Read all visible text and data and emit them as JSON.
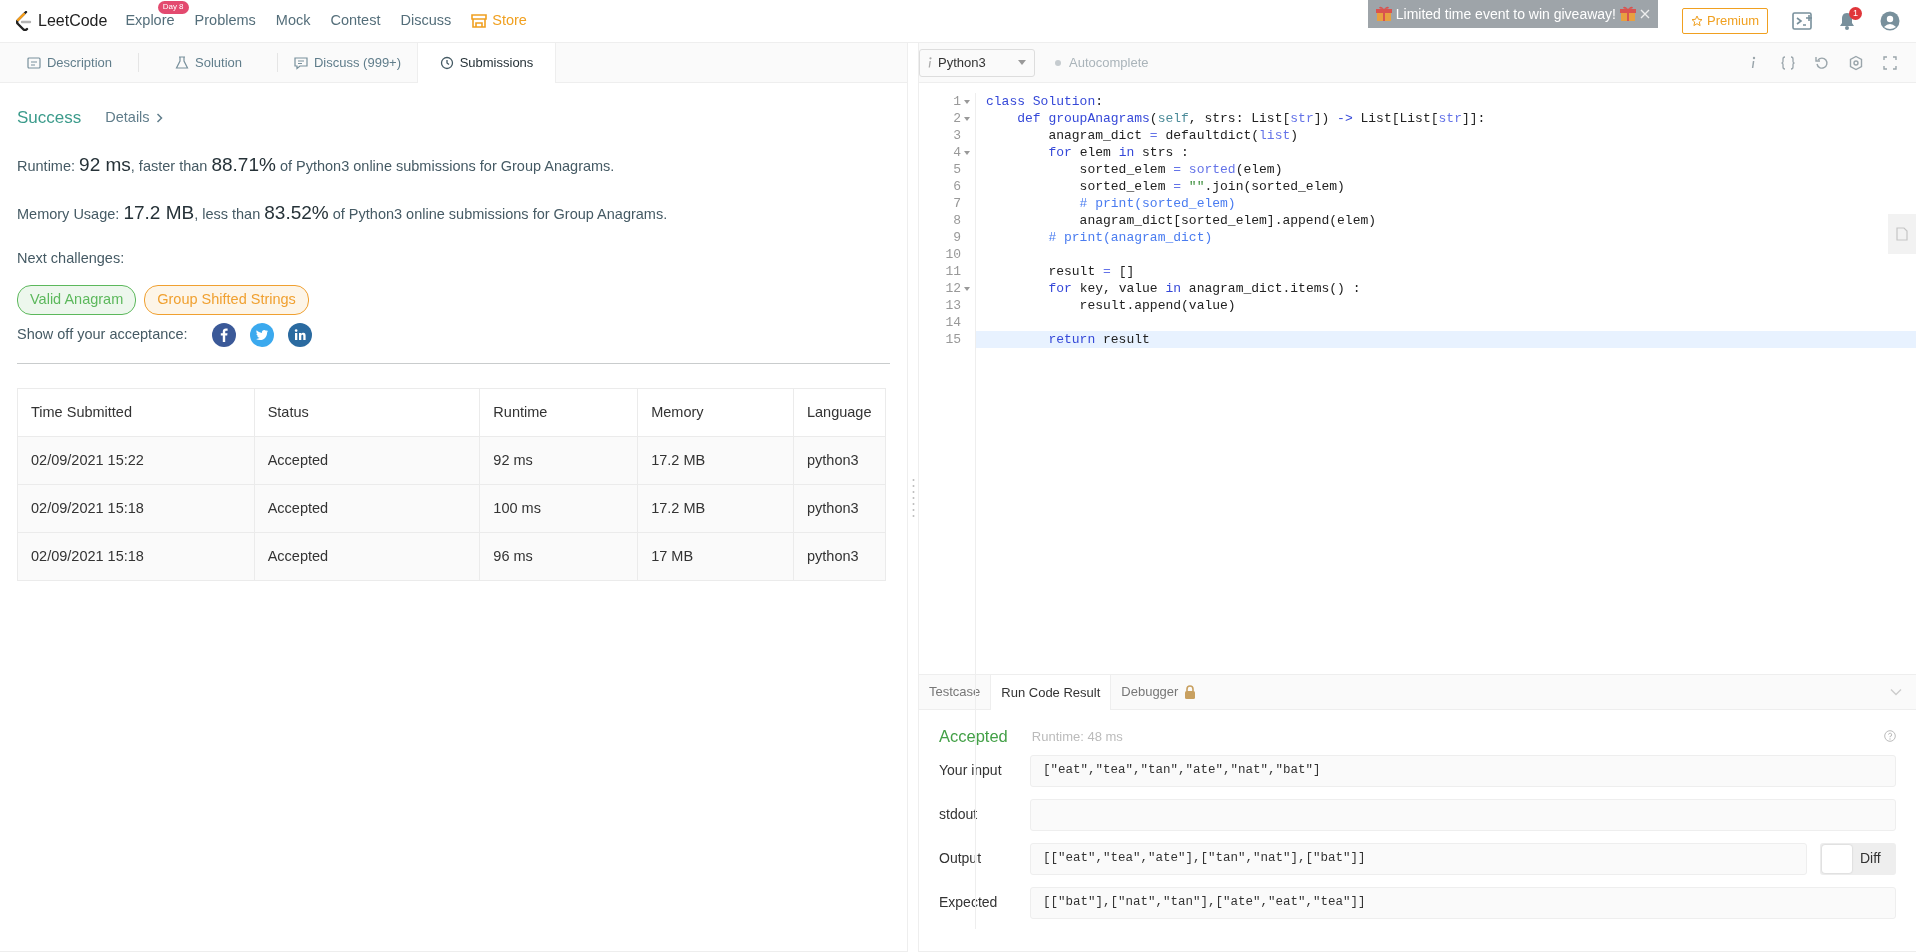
{
  "nav": {
    "logo": "LeetCode",
    "items": [
      {
        "label": "Explore",
        "badge": "Day 8",
        "kind": "plain"
      },
      {
        "label": "Problems",
        "kind": "plain"
      },
      {
        "label": "Mock",
        "kind": "plain"
      },
      {
        "label": "Contest",
        "kind": "plain"
      },
      {
        "label": "Discuss",
        "kind": "plain"
      },
      {
        "label": "Store",
        "kind": "store"
      }
    ],
    "toast": "Limited time event to win giveaway!",
    "premium": "Premium",
    "notifications": "1"
  },
  "left_tabs": [
    {
      "label": "Description",
      "selected": false
    },
    {
      "label": "Solution",
      "selected": false
    },
    {
      "label": "Discuss (999+)",
      "selected": false
    },
    {
      "label": "Submissions",
      "selected": true
    }
  ],
  "submission": {
    "status": "Success",
    "details": "Details",
    "stats": [
      [
        {
          "text": "Runtime: ",
          "big": false
        },
        {
          "text": "92 ms",
          "big": true
        },
        {
          "text": ", faster than ",
          "big": false
        },
        {
          "text": "88.71%",
          "big": true
        },
        {
          "text": " of Python3 online submissions for Group Anagrams.",
          "big": false
        }
      ],
      [
        {
          "text": "Memory Usage: ",
          "big": false
        },
        {
          "text": "17.2 MB",
          "big": true
        },
        {
          "text": ", less than ",
          "big": false
        },
        {
          "text": "83.52%",
          "big": true
        },
        {
          "text": " of Python3 online submissions for Group Anagrams.",
          "big": false
        }
      ]
    ],
    "next_label": "Next challenges:",
    "challenges": [
      {
        "label": "Valid Anagram",
        "color": "#5cb85c"
      },
      {
        "label": "Group Shifted Strings",
        "color": "#f0a030"
      }
    ],
    "share_label": "Show off your acceptance:",
    "share": [
      {
        "kind": "facebook"
      },
      {
        "kind": "twitter"
      },
      {
        "kind": "linkedin"
      }
    ]
  },
  "table": {
    "columns": [
      "Time Submitted",
      "Status",
      "Runtime",
      "Memory",
      "Language"
    ],
    "rows": [
      [
        "02/09/2021 15:22",
        "Accepted",
        "92 ms",
        "17.2 MB",
        "python3"
      ],
      [
        "02/09/2021 15:18",
        "Accepted",
        "100 ms",
        "17.2 MB",
        "python3"
      ],
      [
        "02/09/2021 15:18",
        "Accepted",
        "96 ms",
        "17 MB",
        "python3"
      ]
    ]
  },
  "editor": {
    "language": "Python3",
    "autocomplete": {
      "label": "Autocomplete",
      "on": false
    },
    "lines": [
      {
        "number": "1",
        "foldable": true,
        "highlighted": false,
        "tokens": [
          {
            "kind": "kw",
            "text": "class Solution"
          },
          {
            "kind": "plain",
            "text": ":"
          }
        ]
      },
      {
        "number": "2",
        "foldable": true,
        "highlighted": false,
        "tokens": [
          {
            "kind": "kw",
            "text": "    def groupAnagrams"
          },
          {
            "kind": "plain",
            "text": "("
          },
          {
            "kind": "self",
            "text": "self"
          },
          {
            "kind": "plain",
            "text": ", strs: List["
          },
          {
            "kind": "builtin",
            "text": "str"
          },
          {
            "kind": "plain",
            "text": "]) "
          },
          {
            "kind": "kw",
            "text": "->"
          },
          {
            "kind": "plain",
            "text": " List[List["
          },
          {
            "kind": "builtin",
            "text": "str"
          },
          {
            "kind": "plain",
            "text": "]]:"
          }
        ]
      },
      {
        "number": "3",
        "foldable": false,
        "highlighted": false,
        "tokens": [
          {
            "kind": "plain",
            "text": "        anagram_dict "
          },
          {
            "kind": "builtin",
            "text": "="
          },
          {
            "kind": "plain",
            "text": " defaultdict("
          },
          {
            "kind": "builtin",
            "text": "list"
          },
          {
            "kind": "plain",
            "text": ")"
          }
        ]
      },
      {
        "number": "4",
        "foldable": true,
        "highlighted": false,
        "tokens": [
          {
            "kind": "kw",
            "text": "        for"
          },
          {
            "kind": "plain",
            "text": " elem "
          },
          {
            "kind": "kw",
            "text": "in"
          },
          {
            "kind": "plain",
            "text": " strs :"
          }
        ]
      },
      {
        "number": "5",
        "foldable": false,
        "highlighted": false,
        "tokens": [
          {
            "kind": "plain",
            "text": "            sorted_elem "
          },
          {
            "kind": "builtin",
            "text": "= sorted"
          },
          {
            "kind": "plain",
            "text": "(elem)"
          }
        ]
      },
      {
        "number": "6",
        "foldable": false,
        "highlighted": false,
        "tokens": [
          {
            "kind": "plain",
            "text": "            sorted_elem "
          },
          {
            "kind": "builtin",
            "text": "="
          },
          {
            "kind": "str",
            "text": " \"\""
          },
          {
            "kind": "plain",
            "text": ".join(sorted_elem)"
          }
        ]
      },
      {
        "number": "7",
        "foldable": false,
        "highlighted": false,
        "tokens": [
          {
            "kind": "comment",
            "text": "            # print(sorted_elem)"
          }
        ]
      },
      {
        "number": "8",
        "foldable": false,
        "highlighted": false,
        "tokens": [
          {
            "kind": "plain",
            "text": "            anagram_dict[sorted_elem].append(elem)"
          }
        ]
      },
      {
        "number": "9",
        "foldable": false,
        "highlighted": false,
        "tokens": [
          {
            "kind": "comment",
            "text": "        # print(anagram_dict)"
          }
        ]
      },
      {
        "number": "10",
        "foldable": false,
        "highlighted": false
      },
      {
        "number": "11",
        "foldable": false,
        "highlighted": false,
        "tokens": [
          {
            "kind": "plain",
            "text": "        result "
          },
          {
            "kind": "builtin",
            "text": "="
          },
          {
            "kind": "plain",
            "text": " []"
          }
        ]
      },
      {
        "number": "12",
        "foldable": true,
        "highlighted": false,
        "tokens": [
          {
            "kind": "kw",
            "text": "        for"
          },
          {
            "kind": "plain",
            "text": " key, value "
          },
          {
            "kind": "kw",
            "text": "in"
          },
          {
            "kind": "plain",
            "text": " anagram_dict.items() :"
          }
        ]
      },
      {
        "number": "13",
        "foldable": false,
        "highlighted": false,
        "tokens": [
          {
            "kind": "plain",
            "text": "            result.append(value)"
          }
        ]
      },
      {
        "number": "14",
        "foldable": false,
        "highlighted": false
      },
      {
        "number": "15",
        "foldable": false,
        "highlighted": true,
        "tokens": [
          {
            "kind": "kw",
            "text": "        return"
          },
          {
            "kind": "plain",
            "text": " result"
          }
        ]
      }
    ]
  },
  "console": {
    "tabs": [
      {
        "label": "Testcase",
        "selected": false,
        "locked": false
      },
      {
        "label": "Run Code Result",
        "selected": true,
        "locked": false
      },
      {
        "label": "Debugger",
        "selected": false,
        "locked": true
      }
    ],
    "result": {
      "status": "Accepted",
      "runtime": "Runtime: 48 ms"
    },
    "fields": [
      {
        "label": "Your input",
        "value": "[\"eat\",\"tea\",\"tan\",\"ate\",\"nat\",\"bat\"]"
      },
      {
        "label": "stdout"
      },
      {
        "label": "Output",
        "value": "[[\"eat\",\"tea\",\"ate\"],[\"tan\",\"nat\"],[\"bat\"]]",
        "diff": {
          "label": "Diff",
          "on": false
        }
      },
      {
        "label": "Expected",
        "value": "[[\"bat\"],[\"nat\",\"tan\"],[\"ate\",\"eat\",\"tea\"]]"
      }
    ]
  }
}
